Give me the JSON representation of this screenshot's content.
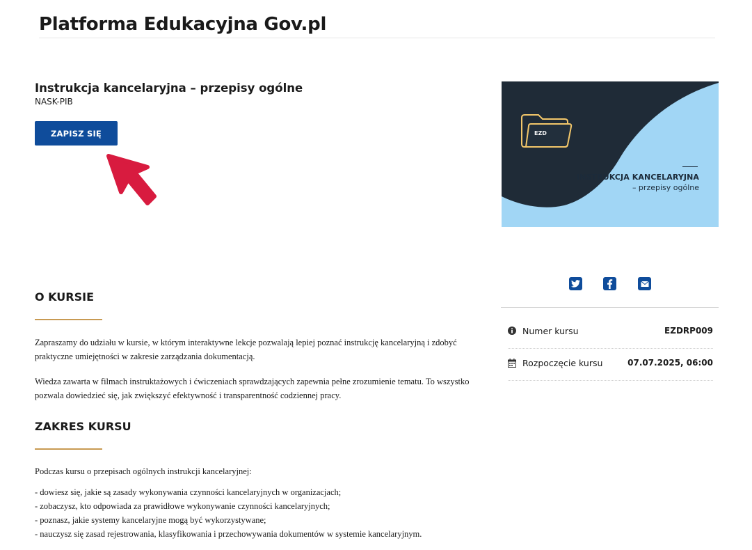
{
  "header": {
    "site_title": "Platforma Edukacyjna Gov.pl"
  },
  "course": {
    "title": "Instrukcja kancelaryjna – przepisy ogólne",
    "provider": "NASK-PIB",
    "enroll_label": "ZAPISZ SIĘ"
  },
  "banner": {
    "logo_text": "EZD",
    "title": "INSTRUKCJA KANCELARYJNA",
    "subtitle": "– przepisy ogólne"
  },
  "about": {
    "heading": "O KURSIE",
    "paragraphs": [
      "Zapraszamy do udziału w kursie, w którym interaktywne lekcje pozwalają lepiej poznać instrukcję kancelaryjną i zdobyć praktyczne umiejętności w zakresie zarządzania dokumentacją.",
      "Wiedza zawarta w filmach instruktażowych i ćwiczeniach sprawdzających zapewnia pełne zrozumienie tematu. To wszystko pozwala dowiedzieć się, jak zwiększyć efektywność i transparentność codziennej pracy."
    ]
  },
  "scope": {
    "heading": "ZAKRES KURSU",
    "intro": "Podczas kursu o przepisach ogólnych instrukcji kancelaryjnej:",
    "items": [
      "- dowiesz się, jakie są zasady wykonywania czynności kancelaryjnych w organizacjach;",
      "- zobaczysz, kto odpowiada za prawidłowe wykonywanie czynności kancelaryjnych;",
      "- poznasz, jakie systemy kancelaryjne mogą być wykorzystywane;",
      "- nauczysz się zasad rejestrowania, klasyfikowania i przechowywania dokumentów w systemie kancelaryjnym."
    ]
  },
  "share": {
    "icons": [
      "twitter-icon",
      "facebook-icon",
      "envelope-icon"
    ],
    "color": "#0f4c9b"
  },
  "info": {
    "course_number_label": "Numer kursu",
    "course_number_value": "EZDRP009",
    "start_label": "Rozpoczęcie kursu",
    "start_value": "07.07.2025, 06:00"
  },
  "colors": {
    "accent": "#0f4c9b",
    "underline": "#c89a52",
    "annotation_arrow": "#d81b3f"
  }
}
